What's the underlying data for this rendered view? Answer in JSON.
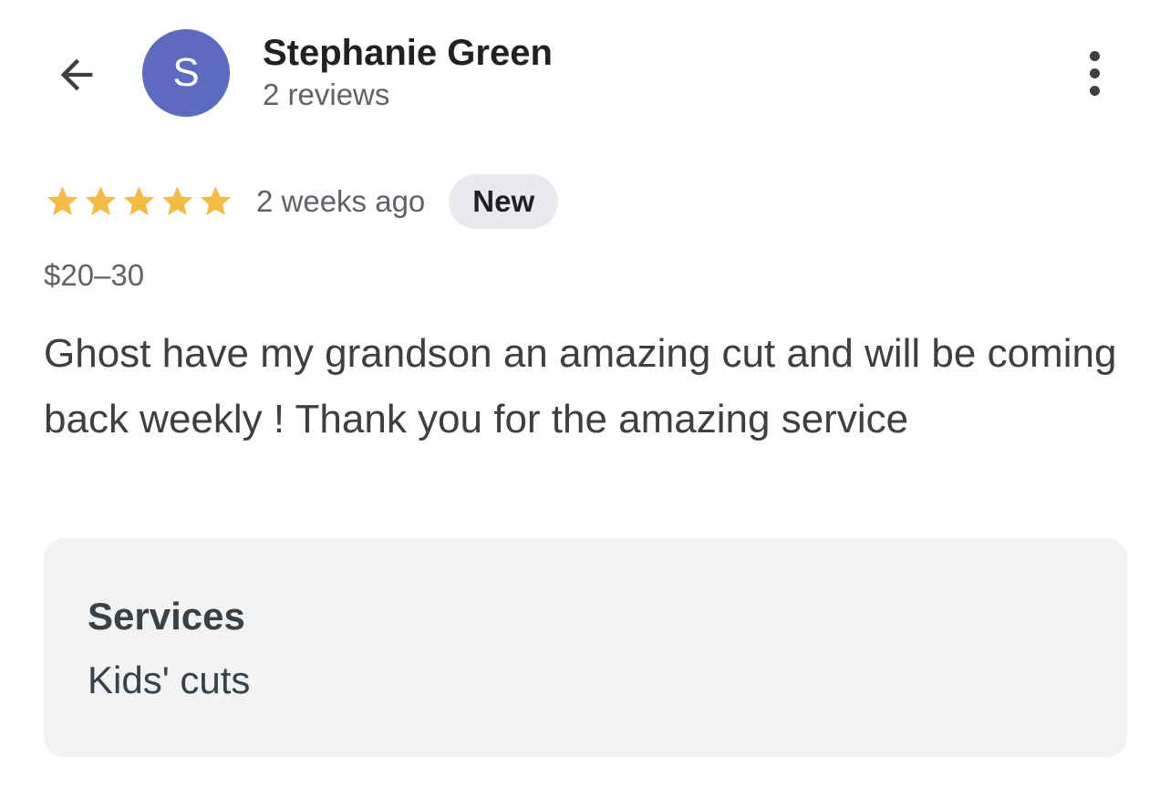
{
  "header": {
    "back_icon": "arrow-back-icon",
    "avatar_letter": "S",
    "avatar_color": "#5c6bc0",
    "reviewer_name": "Stephanie Green",
    "review_count": "2 reviews",
    "more_icon": "more-vert-icon"
  },
  "review": {
    "rating": 5,
    "max_rating": 5,
    "star_icon": "star-icon",
    "star_color": "#f6bb42",
    "time_ago": "2 weeks ago",
    "badge": "New",
    "badge_color": "#e8eaed",
    "price": "$20–30",
    "text": "Ghost have my grandson an amazing cut and will be coming back weekly ! Thank you for the amazing service"
  },
  "services": {
    "heading": "Services",
    "value": "Kids' cuts",
    "card_color": "#f1f3f4"
  },
  "colors": {
    "text_primary": "#202124",
    "text_secondary": "#5f6368",
    "text_body": "#3c4043"
  }
}
